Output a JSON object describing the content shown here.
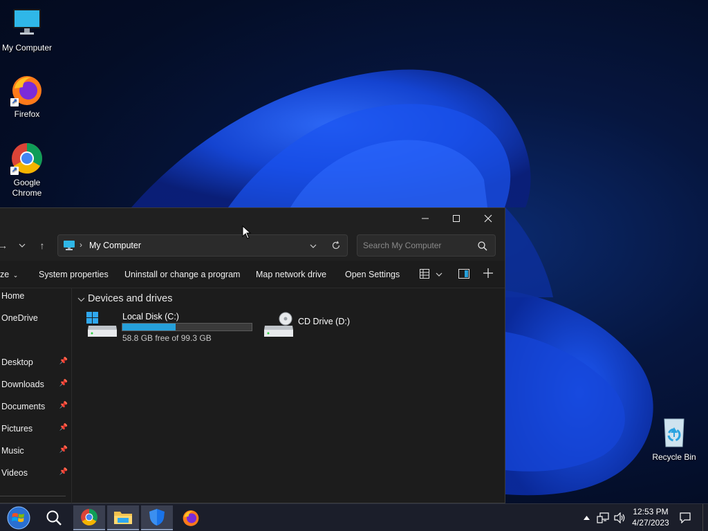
{
  "desktop": {
    "icons": [
      {
        "label": "My Computer"
      },
      {
        "label": "Firefox"
      },
      {
        "label": "Google Chrome"
      },
      {
        "label": "Recycle Bin"
      }
    ]
  },
  "explorer": {
    "address": {
      "location": "My Computer"
    },
    "search": {
      "placeholder": "Search My Computer"
    },
    "commands": [
      {
        "label": "System properties"
      },
      {
        "label": "Uninstall or change a program"
      },
      {
        "label": "Map network drive"
      },
      {
        "label": "Open Settings"
      }
    ],
    "cut_command_label": "ze",
    "sidebar": [
      {
        "label": "Home",
        "pinned": false
      },
      {
        "label": "OneDrive",
        "pinned": false
      },
      {
        "label": "Desktop",
        "pinned": true
      },
      {
        "label": "Downloads",
        "pinned": true
      },
      {
        "label": "Documents",
        "pinned": true
      },
      {
        "label": "Pictures",
        "pinned": true
      },
      {
        "label": "Music",
        "pinned": true
      },
      {
        "label": "Videos",
        "pinned": true
      }
    ],
    "group_header": "Devices and drives",
    "drives": [
      {
        "name": "Local Disk (C:)",
        "free_text": "58.8 GB free of 99.3 GB",
        "used_fraction": 0.41
      },
      {
        "name": "CD Drive (D:)"
      }
    ]
  },
  "taskbar": {
    "apps": [
      "start-orb",
      "search",
      "chrome",
      "file-explorer",
      "windows-security",
      "firefox"
    ],
    "clock": {
      "time": "12:53 PM",
      "date": "4/27/2023"
    }
  },
  "colors": {
    "accent": "#26a0da",
    "window_bg": "#1c1c1c",
    "taskbar_bg": "#1b1e2a"
  }
}
